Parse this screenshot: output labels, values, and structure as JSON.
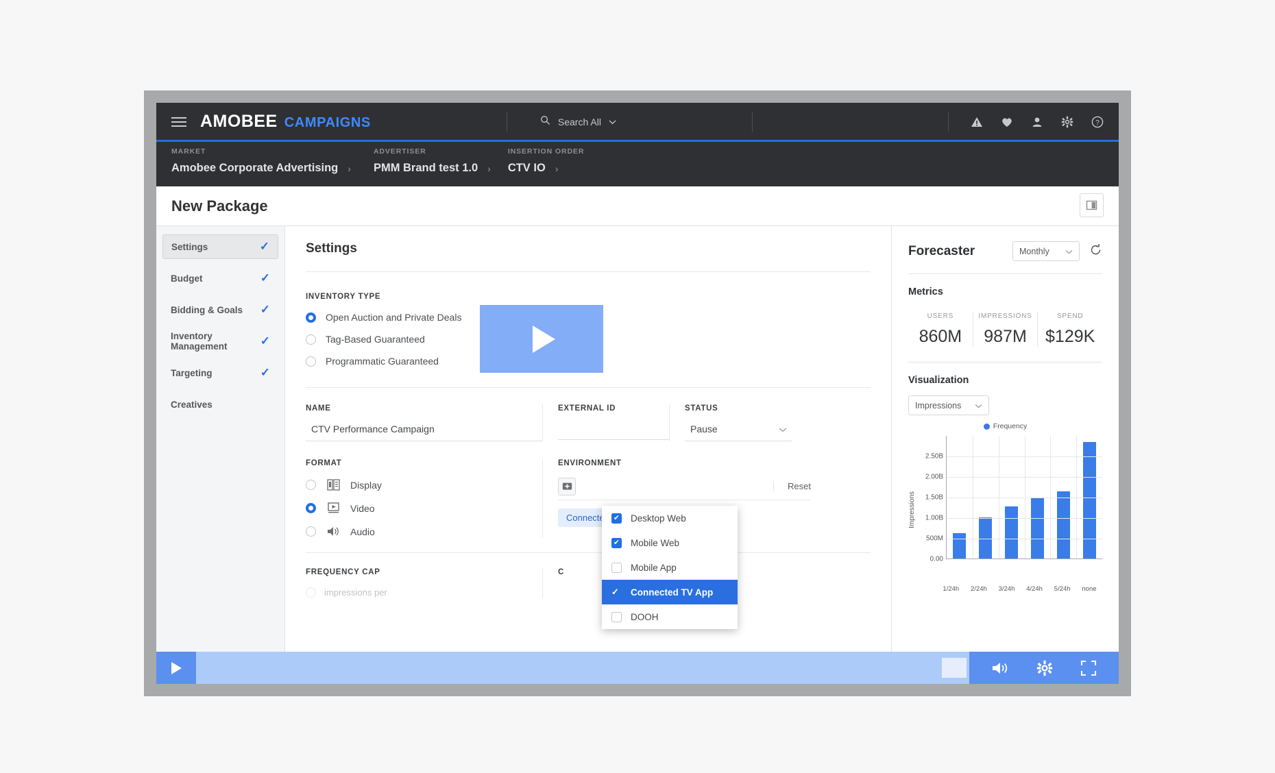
{
  "topnav": {
    "menu_icon": "hamburger-icon",
    "brand_main": "AMOBEE",
    "brand_sub": "CAMPAIGNS",
    "search_label": "Search All",
    "search_icon": "search-icon",
    "icons": [
      "alert-triangle-icon",
      "heart-icon",
      "user-icon",
      "gear-icon",
      "help-icon"
    ],
    "accent": "#1f6fe5"
  },
  "breadcrumb": {
    "items": [
      {
        "label": "MARKET",
        "value": "Amobee Corporate Advertising"
      },
      {
        "label": "ADVERTISER",
        "value": "PMM Brand test 1.0"
      },
      {
        "label": "INSERTION ORDER",
        "value": "CTV IO"
      }
    ],
    "separator": "›"
  },
  "page": {
    "title": "New Package",
    "panel_toggle_icon": "panel-layout-icon"
  },
  "sidebar": {
    "items": [
      {
        "label": "Settings",
        "complete": true,
        "active": true
      },
      {
        "label": "Budget",
        "complete": true,
        "active": false
      },
      {
        "label": "Bidding & Goals",
        "complete": true,
        "active": false
      },
      {
        "label": "Inventory Management",
        "complete": true,
        "active": false
      },
      {
        "label": "Targeting",
        "complete": true,
        "active": false
      },
      {
        "label": "Creatives",
        "complete": false,
        "active": false
      }
    ],
    "check_glyph": "✓"
  },
  "settings": {
    "heading": "Settings",
    "inventory_type": {
      "label": "INVENTORY TYPE",
      "options": [
        {
          "label": "Open Auction and Private Deals",
          "selected": true
        },
        {
          "label": "Tag-Based Guaranteed",
          "selected": false
        },
        {
          "label": "Programmatic Guaranteed",
          "selected": false
        }
      ]
    },
    "name": {
      "label": "NAME",
      "value": "CTV Performance Campaign"
    },
    "external_id": {
      "label": "EXTERNAL ID",
      "value": ""
    },
    "status": {
      "label": "STATUS",
      "value": "Pause"
    },
    "format": {
      "label": "FORMAT",
      "options": [
        {
          "label": "Display",
          "icon": "display-icon",
          "selected": false
        },
        {
          "label": "Video",
          "icon": "video-icon",
          "selected": true
        },
        {
          "label": "Audio",
          "icon": "audio-icon",
          "selected": false
        }
      ]
    },
    "environment": {
      "label": "ENVIRONMENT",
      "add_icon": "plus-icon",
      "reset_label": "Reset",
      "chip": "Connected ...",
      "dropdown_options": [
        {
          "label": "Desktop Web",
          "checked": true,
          "highlighted": false
        },
        {
          "label": "Mobile Web",
          "checked": true,
          "highlighted": false
        },
        {
          "label": "Mobile App",
          "checked": false,
          "highlighted": false
        },
        {
          "label": "Connected TV App",
          "checked": true,
          "highlighted": true
        },
        {
          "label": "DOOH",
          "checked": false,
          "highlighted": false
        }
      ]
    },
    "frequency_cap": {
      "label": "FREQUENCY CAP",
      "partial_text": "impressions per"
    },
    "cutoff": {
      "label": "C"
    }
  },
  "forecaster": {
    "title": "Forecaster",
    "period": "Monthly",
    "refresh_icon": "refresh-icon",
    "metrics_heading": "Metrics",
    "metrics": [
      {
        "label": "USERS",
        "value": "860M"
      },
      {
        "label": "IMPRESSIONS",
        "value": "987M"
      },
      {
        "label": "SPEND",
        "value": "$129K"
      }
    ],
    "visualization_heading": "Visualization",
    "visualization_metric": "Impressions"
  },
  "chart_data": {
    "type": "bar",
    "title": "",
    "categories": [
      "1/24h",
      "2/24h",
      "3/24h",
      "4/24h",
      "5/24h",
      "none"
    ],
    "values": [
      0.62,
      1.0,
      1.27,
      1.47,
      1.64,
      2.83
    ],
    "value_unit": "B",
    "series": [
      {
        "name": "Frequency",
        "values": [
          0.62,
          1.0,
          1.27,
          1.47,
          1.64,
          2.83
        ],
        "color": "#3a7ce8"
      }
    ],
    "xlabel": "",
    "ylabel": "Impressions",
    "ytick_labels": [
      "0.00",
      "500M",
      "1.00B",
      "1.50B",
      "2.00B",
      "2.50B"
    ],
    "ytick_values": [
      0,
      0.5,
      1.0,
      1.5,
      2.0,
      2.5
    ],
    "ylim": [
      0,
      3.0
    ],
    "grid": true,
    "legend": {
      "entries": [
        "Frequency"
      ],
      "position": "top"
    },
    "bar_color": "#3a7ce8"
  },
  "video_player": {
    "play_icon": "play-icon",
    "volume_icon": "volume-icon",
    "settings_icon": "gear-icon",
    "fullscreen_icon": "fullscreen-icon",
    "overlay_play_icon": "play-icon"
  }
}
